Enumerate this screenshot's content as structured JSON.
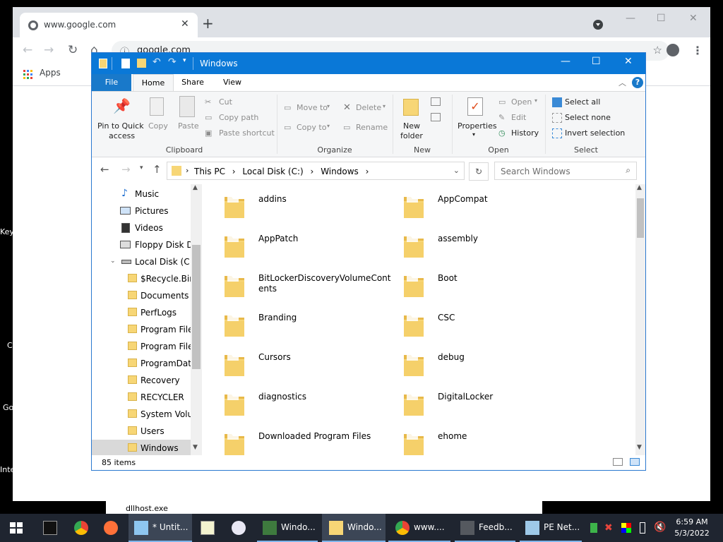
{
  "chrome": {
    "tab_title": "www.google.com",
    "url": "google.com",
    "bookmarks_apps": "Apps"
  },
  "desktop_edge": [
    "Key",
    "C",
    "Go",
    "Inte"
  ],
  "background_window": {
    "item": "dllhost.exe"
  },
  "explorer": {
    "title": "Windows",
    "ribbon_tabs": [
      "File",
      "Home",
      "Share",
      "View"
    ],
    "clipboard": {
      "pin_label_1": "Pin to Quick",
      "pin_label_2": "access",
      "copy": "Copy",
      "paste": "Paste",
      "cut": "Cut",
      "copy_path": "Copy path",
      "paste_shortcut": "Paste shortcut",
      "group": "Clipboard"
    },
    "organize": {
      "move_to": "Move to",
      "copy_to": "Copy to",
      "delete": "Delete",
      "rename": "Rename",
      "group": "Organize"
    },
    "new": {
      "new_folder_1": "New",
      "new_folder_2": "folder",
      "group": "New"
    },
    "open": {
      "properties": "Properties",
      "open": "Open",
      "edit": "Edit",
      "history": "History",
      "group": "Open"
    },
    "select": {
      "select_all": "Select all",
      "select_none": "Select none",
      "invert_selection": "Invert selection",
      "group": "Select"
    },
    "breadcrumb": [
      "This PC",
      "Local Disk (C:)",
      "Windows"
    ],
    "search_placeholder": "Search Windows",
    "nav_items": [
      {
        "label": "Music",
        "icon": "music-icon"
      },
      {
        "label": "Pictures",
        "icon": "pictures-icon"
      },
      {
        "label": "Videos",
        "icon": "videos-icon"
      },
      {
        "label": "Floppy Disk Dri",
        "icon": "floppy-icon"
      },
      {
        "label": "Local Disk (C:)",
        "icon": "drive-icon"
      },
      {
        "label": "$Recycle.Bin",
        "icon": "folder-icon"
      },
      {
        "label": "Documents a",
        "icon": "folder-icon"
      },
      {
        "label": "PerfLogs",
        "icon": "folder-icon"
      },
      {
        "label": "Program Files",
        "icon": "folder-icon"
      },
      {
        "label": "Program Files",
        "icon": "folder-icon"
      },
      {
        "label": "ProgramData",
        "icon": "folder-icon"
      },
      {
        "label": "Recovery",
        "icon": "folder-icon"
      },
      {
        "label": "RECYCLER",
        "icon": "folder-icon"
      },
      {
        "label": "System Volun",
        "icon": "folder-icon"
      },
      {
        "label": "Users",
        "icon": "folder-icon"
      },
      {
        "label": "Windows",
        "icon": "folder-icon",
        "selected": true
      }
    ],
    "files": [
      "addins",
      "AppCompat",
      "AppPatch",
      "assembly",
      "BitLockerDiscoveryVolumeContents",
      "Boot",
      "Branding",
      "CSC",
      "Cursors",
      "debug",
      "diagnostics",
      "DigitalLocker",
      "Downloaded Program Files",
      "ehome"
    ],
    "status_count": "85 items"
  },
  "taskbar": {
    "items": [
      "* Untit...",
      "Windo...",
      "Windo...",
      "www....",
      "Feedb...",
      "PE Net..."
    ],
    "time": "6:59 AM",
    "date": "5/3/2022"
  }
}
